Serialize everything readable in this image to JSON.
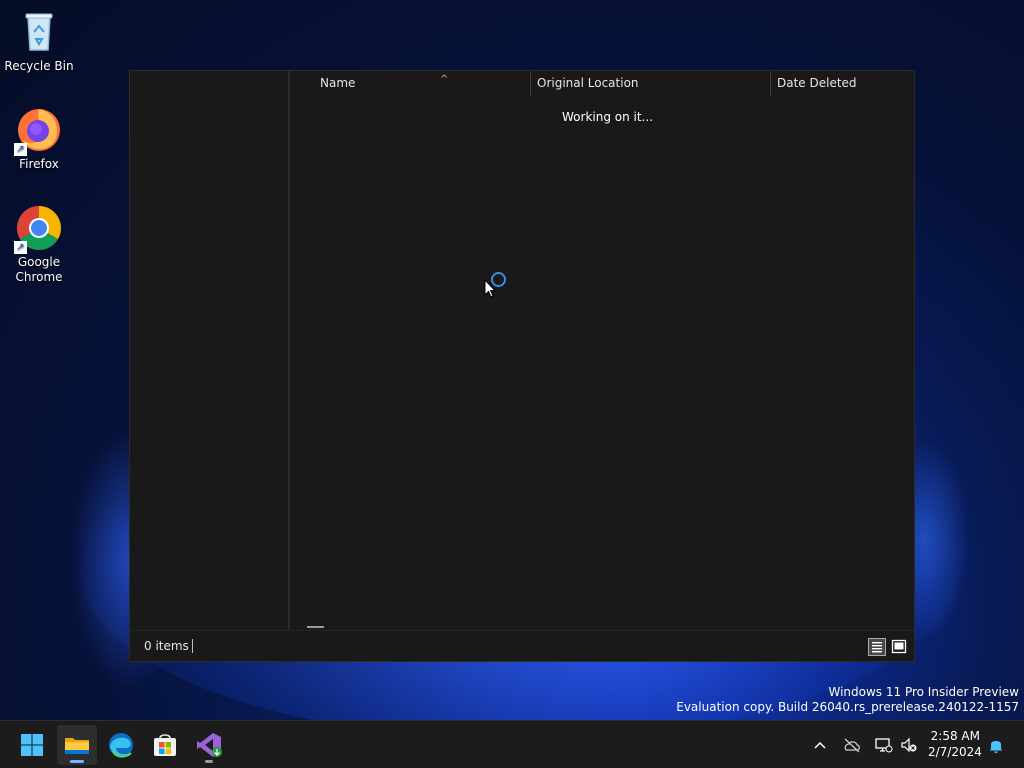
{
  "desktop": {
    "icons": [
      {
        "label": "Recycle Bin"
      },
      {
        "label": "Firefox"
      },
      {
        "label": "Google Chrome"
      }
    ]
  },
  "explorer": {
    "columns": [
      {
        "label": "Name",
        "sorted": "ascending"
      },
      {
        "label": "Original Location"
      },
      {
        "label": "Date Deleted"
      }
    ],
    "loading_text": "Working on it...",
    "status": {
      "item_count": "0 items"
    },
    "view": "details"
  },
  "watermark": {
    "line1": "Windows 11 Pro Insider Preview",
    "line2": "Evaluation copy. Build 26040.rs_prerelease.240122-1157"
  },
  "taskbar": {
    "apps": [
      {
        "icon": "windows-start-icon"
      },
      {
        "icon": "file-explorer-icon",
        "active": true
      },
      {
        "icon": "edge-icon"
      },
      {
        "icon": "microsoft-store-icon"
      },
      {
        "icon": "visual-studio-icon",
        "running": true
      }
    ],
    "tray": [
      "chevron-up-icon",
      "cloud-off-icon",
      "network-icon",
      "volume-muted-icon",
      "notification-bell-icon"
    ],
    "clock": {
      "time": "2:58 AM",
      "date": "2/7/2024"
    }
  },
  "colors": {
    "accent": "#3a8be6",
    "window_bg": "#191919",
    "taskbar_bg": "#1c1c1c"
  }
}
